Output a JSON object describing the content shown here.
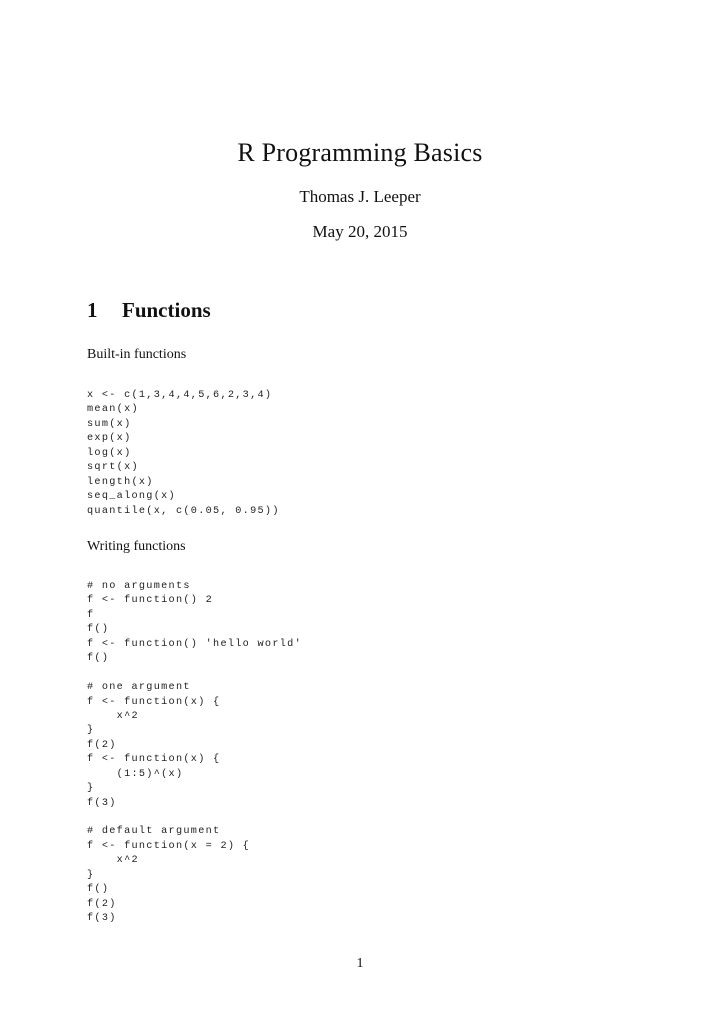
{
  "document": {
    "title": "R Programming Basics",
    "author": "Thomas J. Leeper",
    "date": "May 20, 2015",
    "page_number": "1"
  },
  "section": {
    "number": "1",
    "title": "Functions"
  },
  "paragraphs": {
    "builtin": "Built-in functions",
    "writing": "Writing functions"
  },
  "code_blocks": {
    "builtin": [
      "x <- c(1,3,4,4,5,6,2,3,4)",
      "mean(x)",
      "sum(x)",
      "exp(x)",
      "log(x)",
      "sqrt(x)",
      "length(x)",
      "seq_along(x)",
      "quantile(x, c(0.05, 0.95))"
    ],
    "writing": [
      "# no arguments",
      "f <- function() 2",
      "f",
      "f()",
      "f <- function() 'hello world'",
      "f()",
      "",
      "# one argument",
      "f <- function(x) {",
      "    x^2",
      "}",
      "f(2)",
      "f <- function(x) {",
      "    (1:5)^(x)",
      "}",
      "f(3)",
      "",
      "# default argument",
      "f <- function(x = 2) {",
      "    x^2",
      "}",
      "f()",
      "f(2)",
      "f(3)"
    ]
  }
}
